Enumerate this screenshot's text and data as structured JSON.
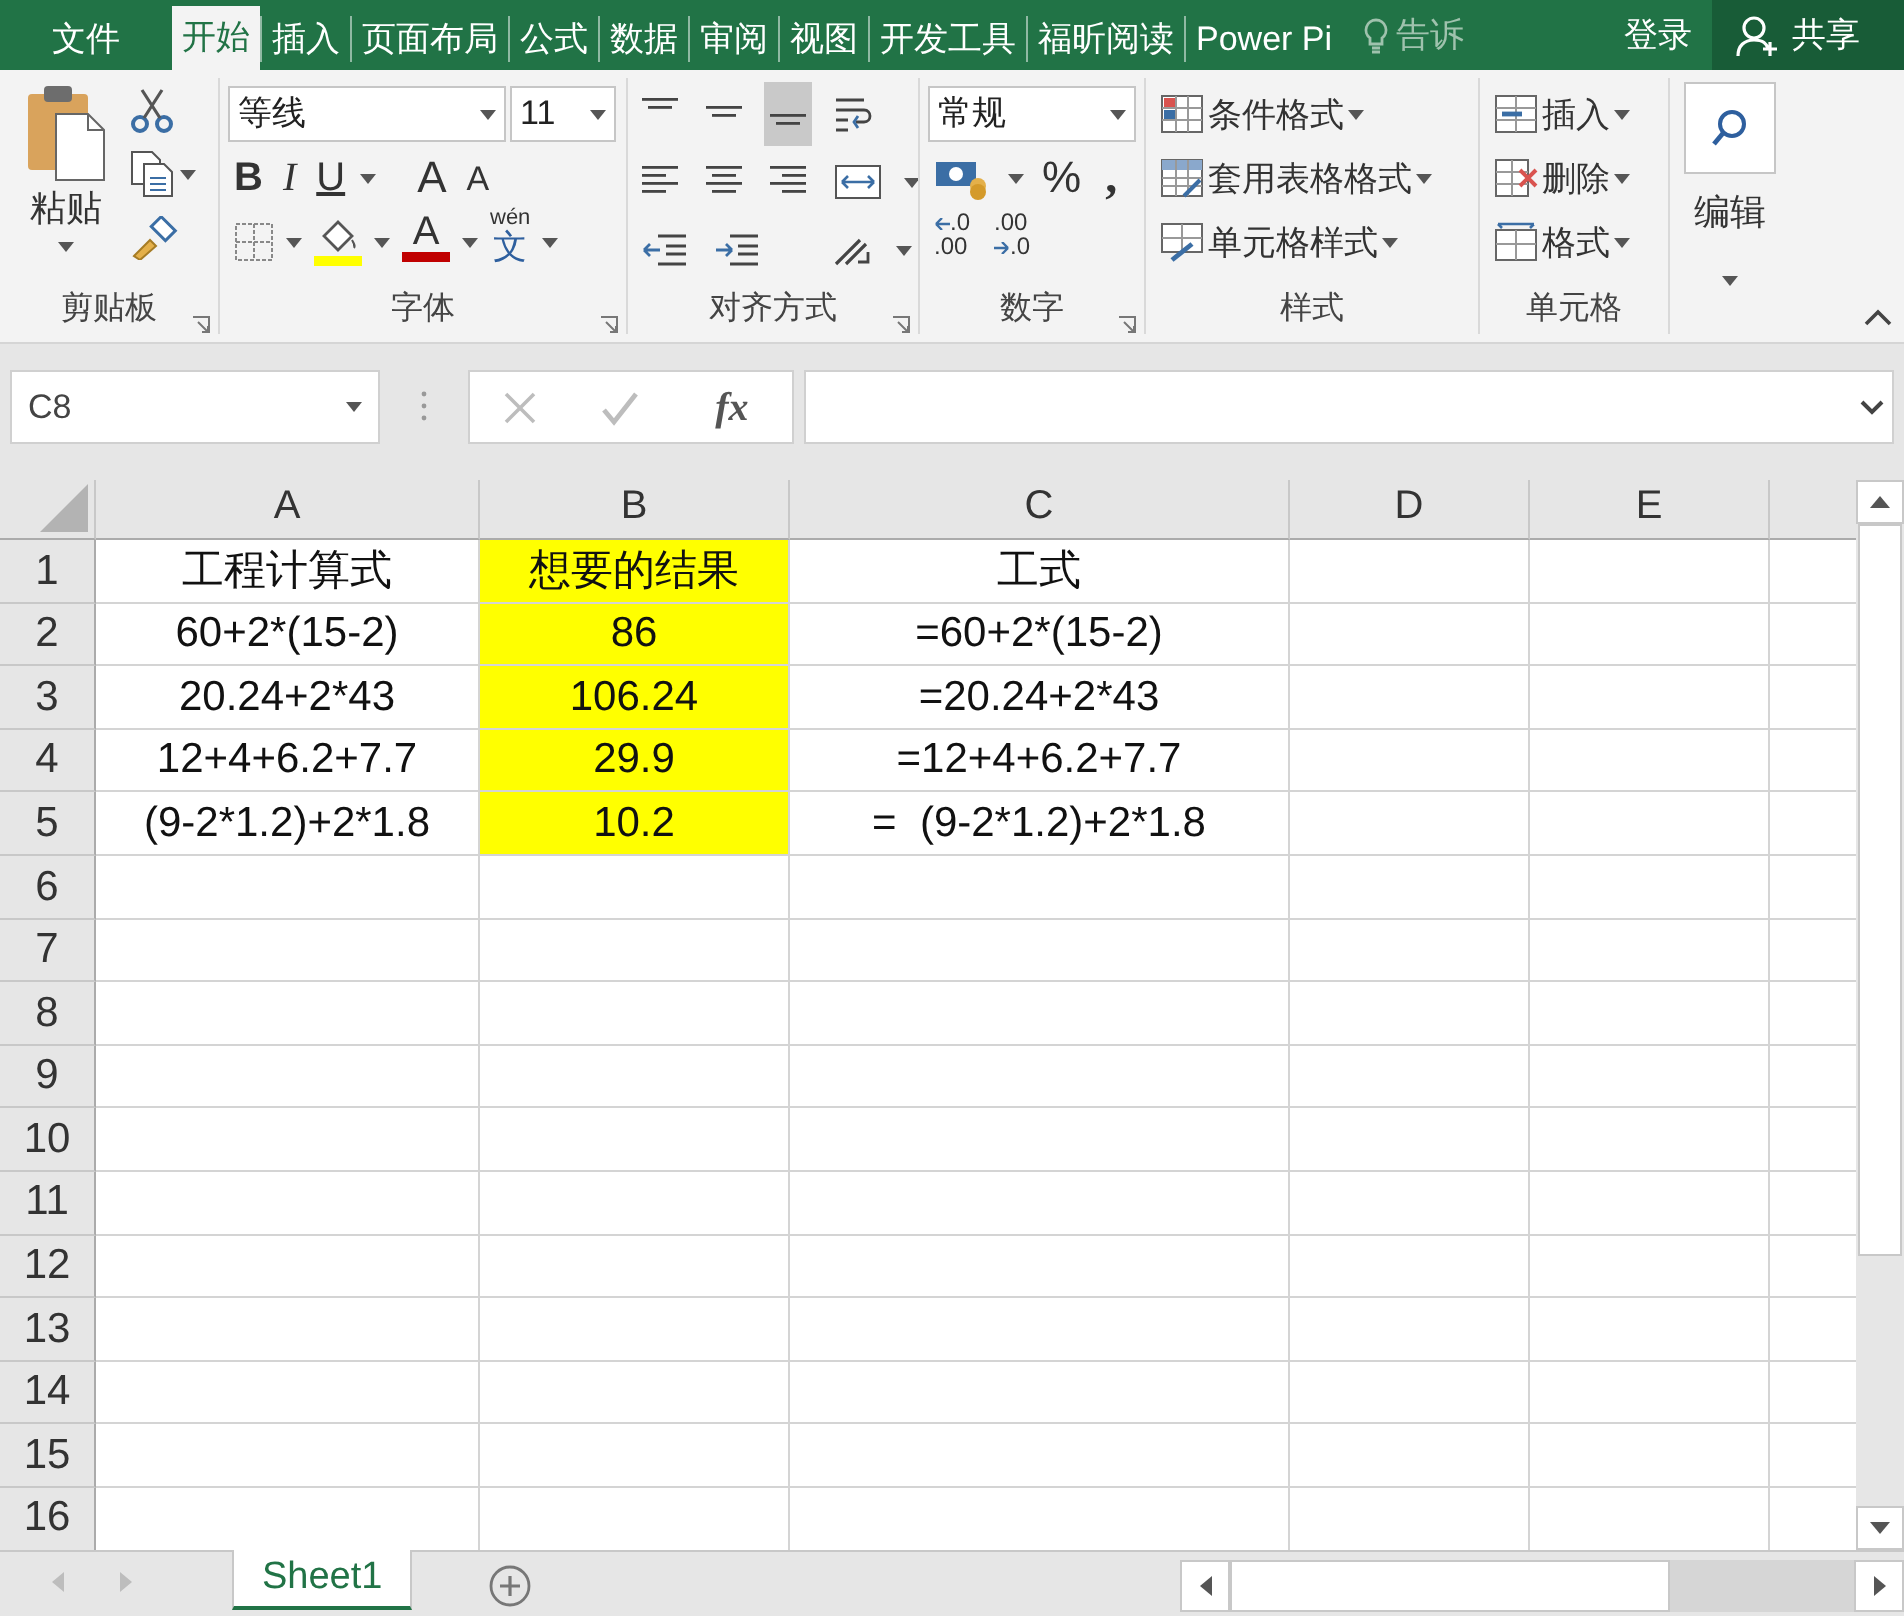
{
  "menu_tabs": [
    {
      "label": "文件",
      "selected": false
    },
    {
      "label": "开始",
      "selected": true
    },
    {
      "label": "插入",
      "selected": false
    },
    {
      "label": "页面布局",
      "selected": false
    },
    {
      "label": "公式",
      "selected": false
    },
    {
      "label": "数据",
      "selected": false
    },
    {
      "label": "审阅",
      "selected": false
    },
    {
      "label": "视图",
      "selected": false
    },
    {
      "label": "开发工具",
      "selected": false
    },
    {
      "label": "福昕阅读",
      "selected": false
    },
    {
      "label": "Power Pi",
      "selected": false
    }
  ],
  "tell_me": "告诉",
  "sign_in": "登录",
  "share": "共享",
  "clipboard": {
    "paste": "粘贴",
    "label": "剪贴板"
  },
  "font": {
    "name": "等线",
    "size": "11",
    "bold": "B",
    "italic": "I",
    "underline": "U",
    "grow": "A",
    "shrink": "A",
    "font_color": "A",
    "phonetic_top": "wén",
    "phonetic_char": "文",
    "label": "字体"
  },
  "alignment": {
    "label": "对齐方式"
  },
  "number": {
    "format": "常规",
    "percent": "%",
    "comma": ",",
    "increase_decimal": [
      ".0",
      ".00"
    ],
    "decrease_decimal": [
      ".00",
      ".0"
    ],
    "label": "数字"
  },
  "styles": {
    "items": [
      "条件格式",
      "套用表格格式",
      "单元格样式"
    ],
    "label": "样式"
  },
  "cells": {
    "items": [
      "插入",
      "删除",
      "格式"
    ],
    "label": "单元格"
  },
  "editing": {
    "label": "编辑"
  },
  "formula_bar": {
    "name_box": "C8",
    "fx": "fx"
  },
  "columns": [
    "A",
    "B",
    "C",
    "D",
    "E"
  ],
  "rows": [
    {
      "number": "1",
      "cells": [
        {
          "text": "工程计算式",
          "highlighted": false
        },
        {
          "text": "想要的结果",
          "highlighted": true
        },
        {
          "text": "工式",
          "highlighted": false
        }
      ]
    },
    {
      "number": "2",
      "cells": [
        {
          "text": "60+2*(15-2)",
          "highlighted": false
        },
        {
          "text": "86",
          "highlighted": true
        },
        {
          "text": "=60+2*(15-2)",
          "highlighted": false
        }
      ]
    },
    {
      "number": "3",
      "cells": [
        {
          "text": "20.24+2*43",
          "highlighted": false
        },
        {
          "text": "106.24",
          "highlighted": true
        },
        {
          "text": "=20.24+2*43",
          "highlighted": false
        }
      ]
    },
    {
      "number": "4",
      "cells": [
        {
          "text": "12+4+6.2+7.7",
          "highlighted": false
        },
        {
          "text": "29.9",
          "highlighted": true
        },
        {
          "text": "=12+4+6.2+7.7",
          "highlighted": false
        }
      ]
    },
    {
      "number": "5",
      "cells": [
        {
          "text": "(9-2*1.2)+2*1.8",
          "highlighted": false
        },
        {
          "text": "10.2",
          "highlighted": true
        },
        {
          "text": "=  (9-2*1.2)+2*1.8",
          "highlighted": false
        }
      ]
    },
    {
      "number": "6"
    },
    {
      "number": "7"
    },
    {
      "number": "8"
    },
    {
      "number": "9"
    },
    {
      "number": "10"
    },
    {
      "number": "11"
    },
    {
      "number": "12"
    },
    {
      "number": "13"
    },
    {
      "number": "14"
    },
    {
      "number": "15"
    },
    {
      "number": "16"
    }
  ],
  "sheet_tabs": [
    {
      "label": "Sheet1",
      "selected": true
    }
  ]
}
